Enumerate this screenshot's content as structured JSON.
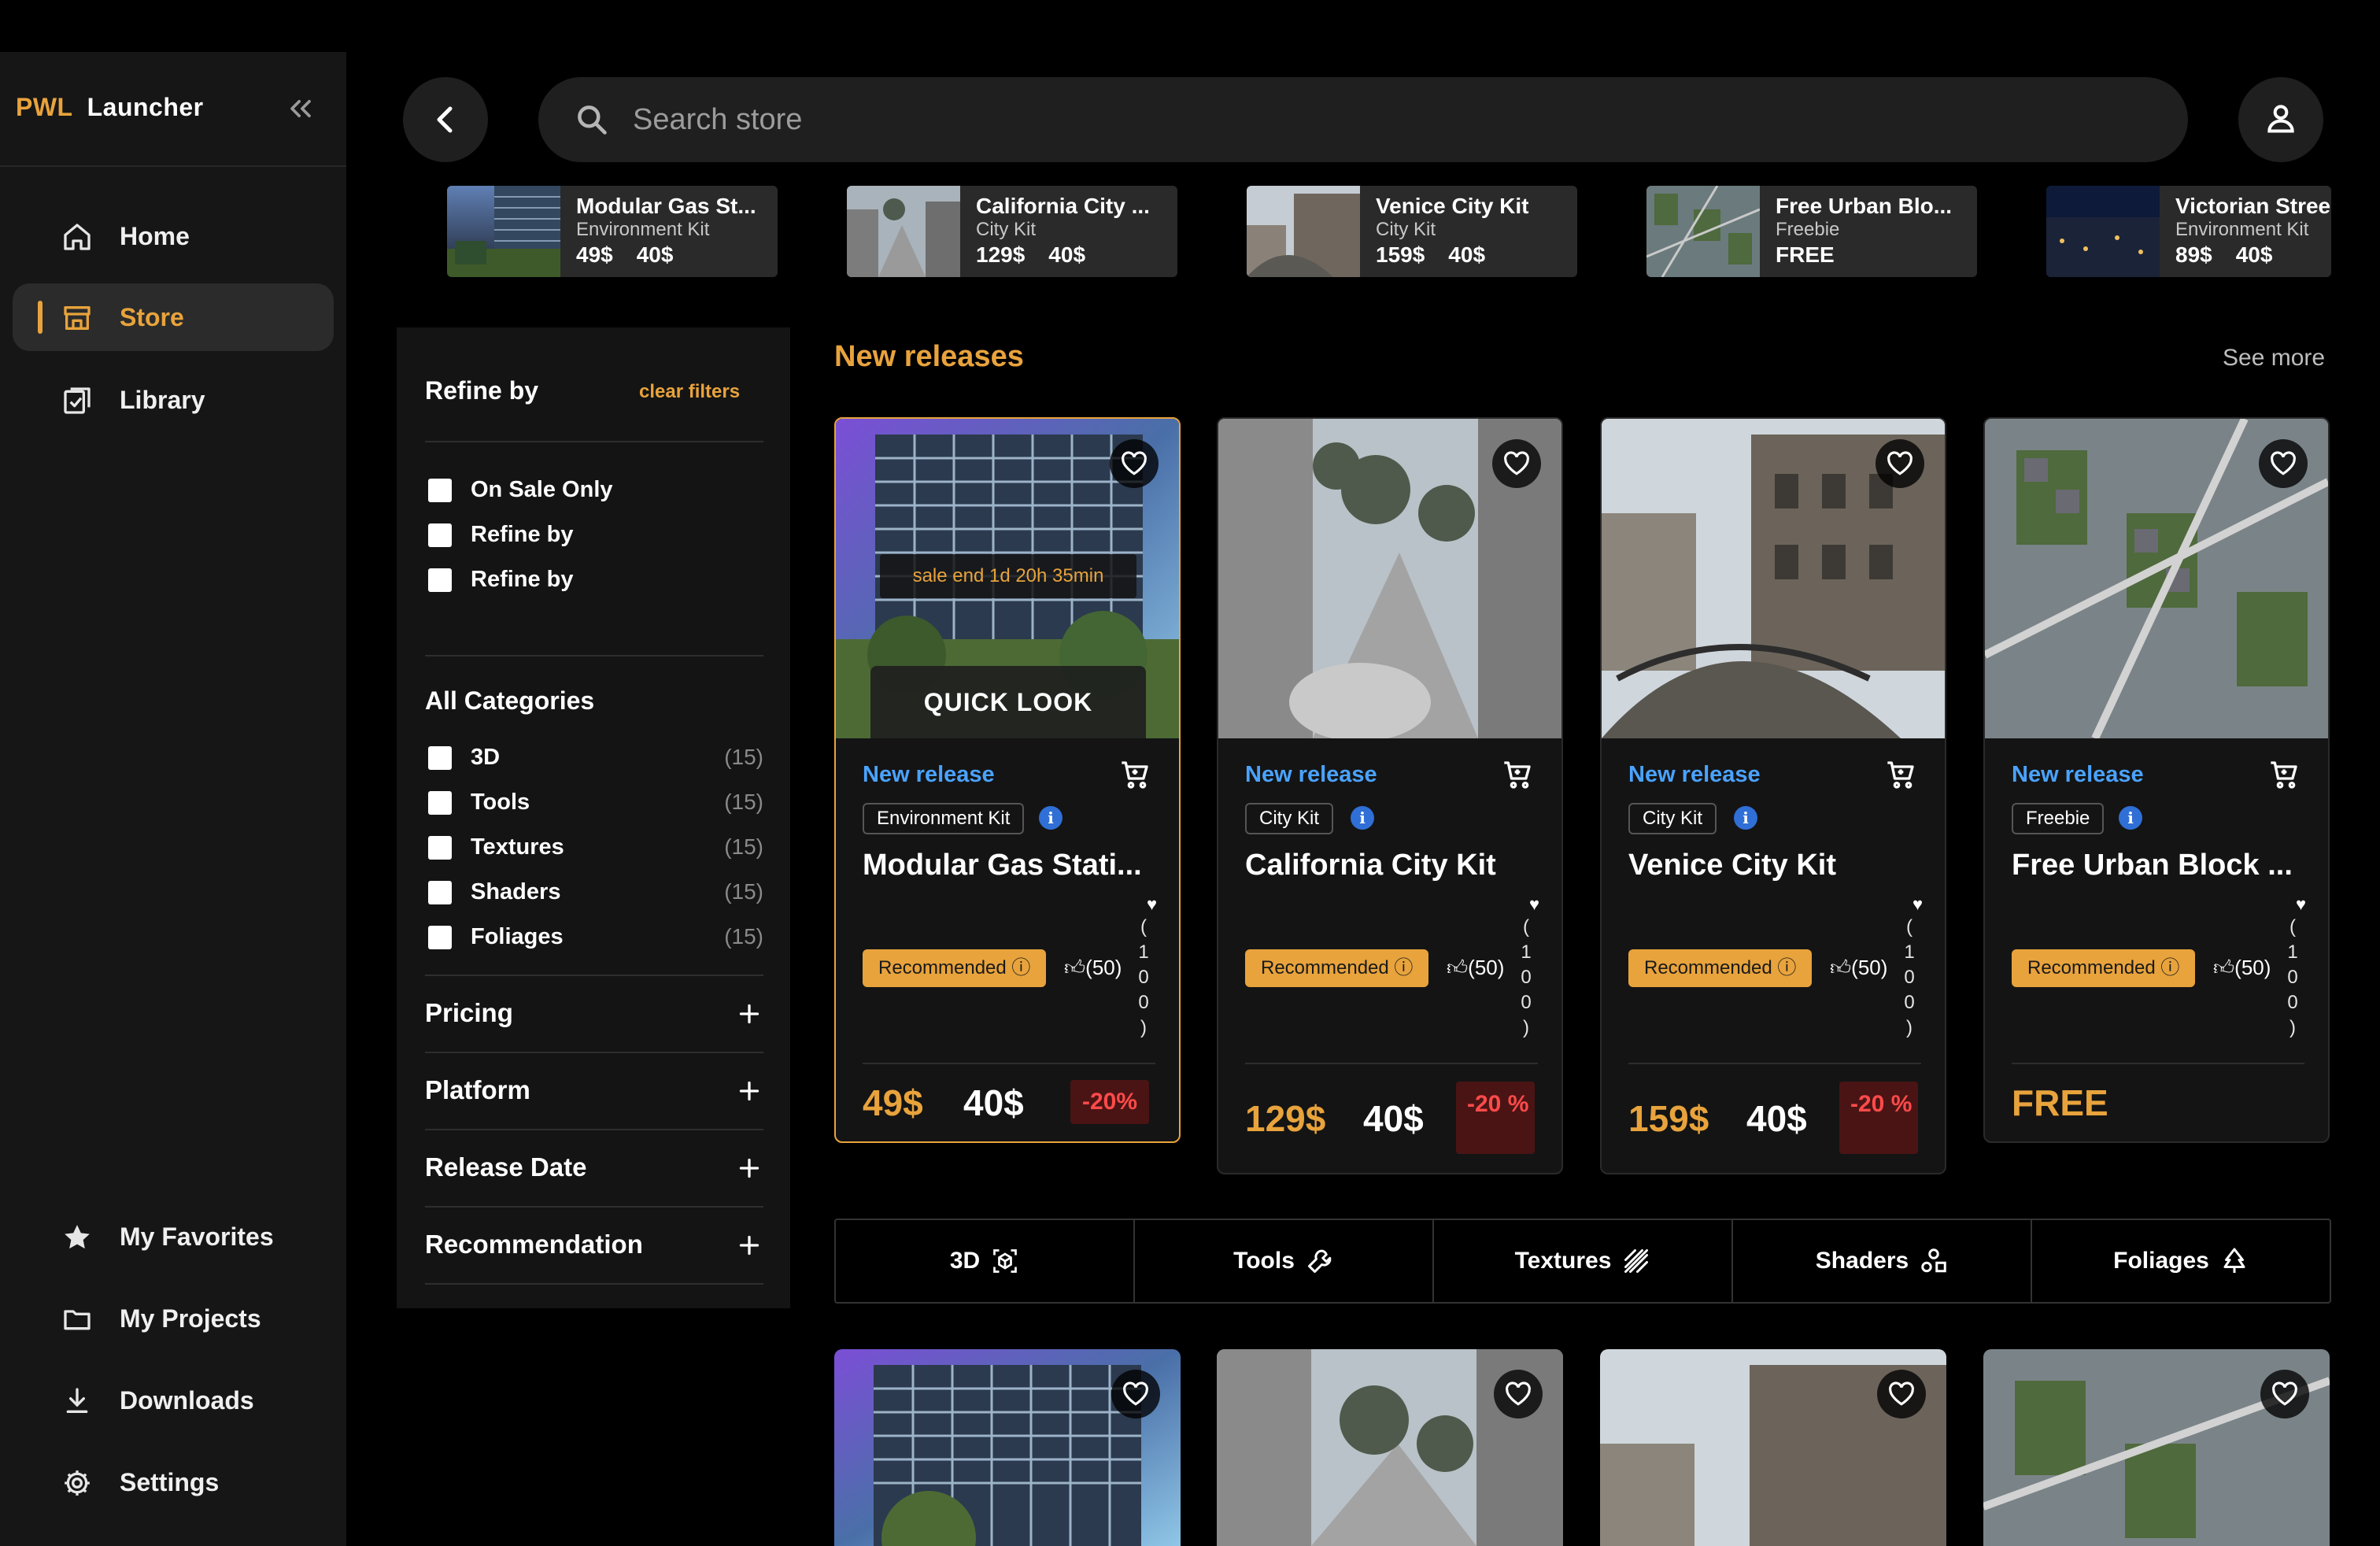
{
  "app": {
    "brand_short": "PWL",
    "brand_name": "Launcher"
  },
  "sidebar": {
    "items": [
      {
        "label": "Home",
        "icon": "home-icon",
        "active": false
      },
      {
        "label": "Store",
        "icon": "store-icon",
        "active": true
      },
      {
        "label": "Library",
        "icon": "library-icon",
        "active": false
      }
    ],
    "bottom_items": [
      {
        "label": "My Favorites",
        "icon": "star-icon"
      },
      {
        "label": "My Projects",
        "icon": "folder-icon"
      },
      {
        "label": "Downloads",
        "icon": "download-icon"
      },
      {
        "label": "Settings",
        "icon": "gear-icon"
      }
    ]
  },
  "search": {
    "placeholder": "Search store",
    "value": ""
  },
  "featured": [
    {
      "title": "Modular Gas St...",
      "category": "Environment Kit",
      "price": "49$",
      "sale": "40$"
    },
    {
      "title": "California City ...",
      "category": "City Kit",
      "price": "129$",
      "sale": "40$"
    },
    {
      "title": "Venice City Kit",
      "category": "City Kit",
      "price": "159$",
      "sale": "40$"
    },
    {
      "title": "Free Urban Blo...",
      "category": "Freebie",
      "price": "FREE",
      "sale": ""
    },
    {
      "title": "Victorian Stree",
      "category": "Environment Kit",
      "price": "89$",
      "sale": "40$"
    }
  ],
  "filters": {
    "title": "Refine by",
    "clear": "clear filters",
    "quick": [
      "On Sale Only",
      "Refine by",
      "Refine by"
    ],
    "categories_title": "All Categories",
    "categories": [
      {
        "label": "3D",
        "count": "(15)"
      },
      {
        "label": "Tools",
        "count": "(15)"
      },
      {
        "label": "Textures",
        "count": "(15)"
      },
      {
        "label": "Shaders",
        "count": "(15)"
      },
      {
        "label": "Foliages",
        "count": "(15)"
      }
    ],
    "sections": [
      "Pricing",
      "Platform",
      "Release Date",
      "Recommendation"
    ]
  },
  "new_releases": {
    "title": "New releases",
    "see_more": "See more",
    "sale_timer": "sale end 1d 20h 35min",
    "quick_look": "QUICK LOOK",
    "cards": [
      {
        "badge": "New release",
        "category": "Environment Kit",
        "name": "Modular Gas Stati...",
        "recommended": "Recommended ⓘ",
        "likes": "(50)",
        "vertical": [
          "(",
          "1",
          "0",
          "0",
          ")"
        ],
        "price": "49$",
        "sale": "40$",
        "discount": "-20%"
      },
      {
        "badge": "New release",
        "category": "City Kit",
        "name": "California City Kit",
        "recommended": "Recommended ⓘ",
        "likes": "(50)",
        "vertical": [
          "(",
          "1",
          "0",
          "0",
          ")"
        ],
        "price": "129$",
        "sale": "40$",
        "discount": "-20 %"
      },
      {
        "badge": "New release",
        "category": "City Kit",
        "name": "Venice City Kit",
        "recommended": "Recommended ⓘ",
        "likes": "(50)",
        "vertical": [
          "(",
          "1",
          "0",
          "0",
          ")"
        ],
        "price": "159$",
        "sale": "40$",
        "discount": "-20 %"
      },
      {
        "badge": "New release",
        "category": "Freebie",
        "name": "Free Urban Block ...",
        "recommended": "Recommended ⓘ",
        "likes": "(50)",
        "vertical": [
          "(",
          "1",
          "0",
          "0",
          ")"
        ],
        "price": "FREE",
        "sale": "",
        "discount": ""
      }
    ]
  },
  "category_bar": [
    "3D",
    "Tools",
    "Textures",
    "Shaders",
    "Foliages"
  ],
  "colors": {
    "accent": "#E8A33C",
    "link_blue": "#4aa3ff",
    "discount_red": "#ff4a4a",
    "bg": "#000000",
    "panel": "#141414"
  }
}
